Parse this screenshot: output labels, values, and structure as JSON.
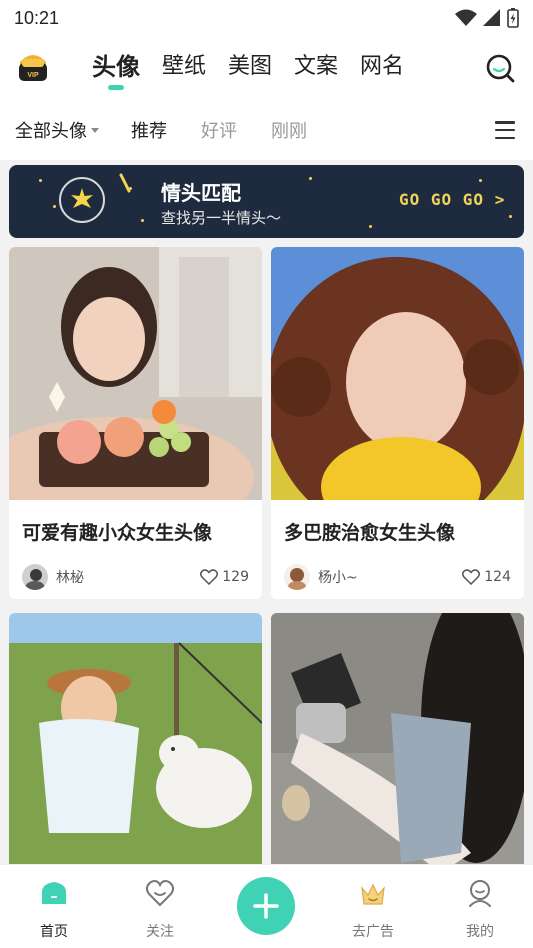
{
  "status_bar": {
    "time": "10:21"
  },
  "top_nav": {
    "vip_logo_text": "VIP",
    "tabs": [
      {
        "label": "头像",
        "active": true
      },
      {
        "label": "壁纸"
      },
      {
        "label": "美图"
      },
      {
        "label": "文案"
      },
      {
        "label": "网名"
      }
    ]
  },
  "sub_nav": {
    "all_label": "全部头像",
    "items": [
      "推荐",
      "好评",
      "刚刚"
    ]
  },
  "banner": {
    "title": "情头匹配",
    "subtitle": "查找另一半情头～",
    "cta": "GO GO GO >"
  },
  "cards": [
    {
      "title": "可爱有趣小众女生头像",
      "user": "林柲",
      "likes": "129"
    },
    {
      "title": "多巴胺治愈女生头像",
      "user": "杨小~",
      "likes": "124"
    },
    {
      "title": "",
      "user": "",
      "likes": ""
    },
    {
      "title": "",
      "user": "",
      "likes": ""
    }
  ],
  "bottom_nav": {
    "items": [
      {
        "label": "首页",
        "icon": "home-icon",
        "active": true
      },
      {
        "label": "关注",
        "icon": "heart-icon"
      },
      {
        "label": "",
        "icon": "plus-icon"
      },
      {
        "label": "去广告",
        "icon": "crown-icon"
      },
      {
        "label": "我的",
        "icon": "profile-icon"
      }
    ]
  },
  "colors": {
    "accent": "#3fd2b5",
    "banner_bg": "#1e2a3d",
    "banner_cta": "#f1d25a"
  }
}
